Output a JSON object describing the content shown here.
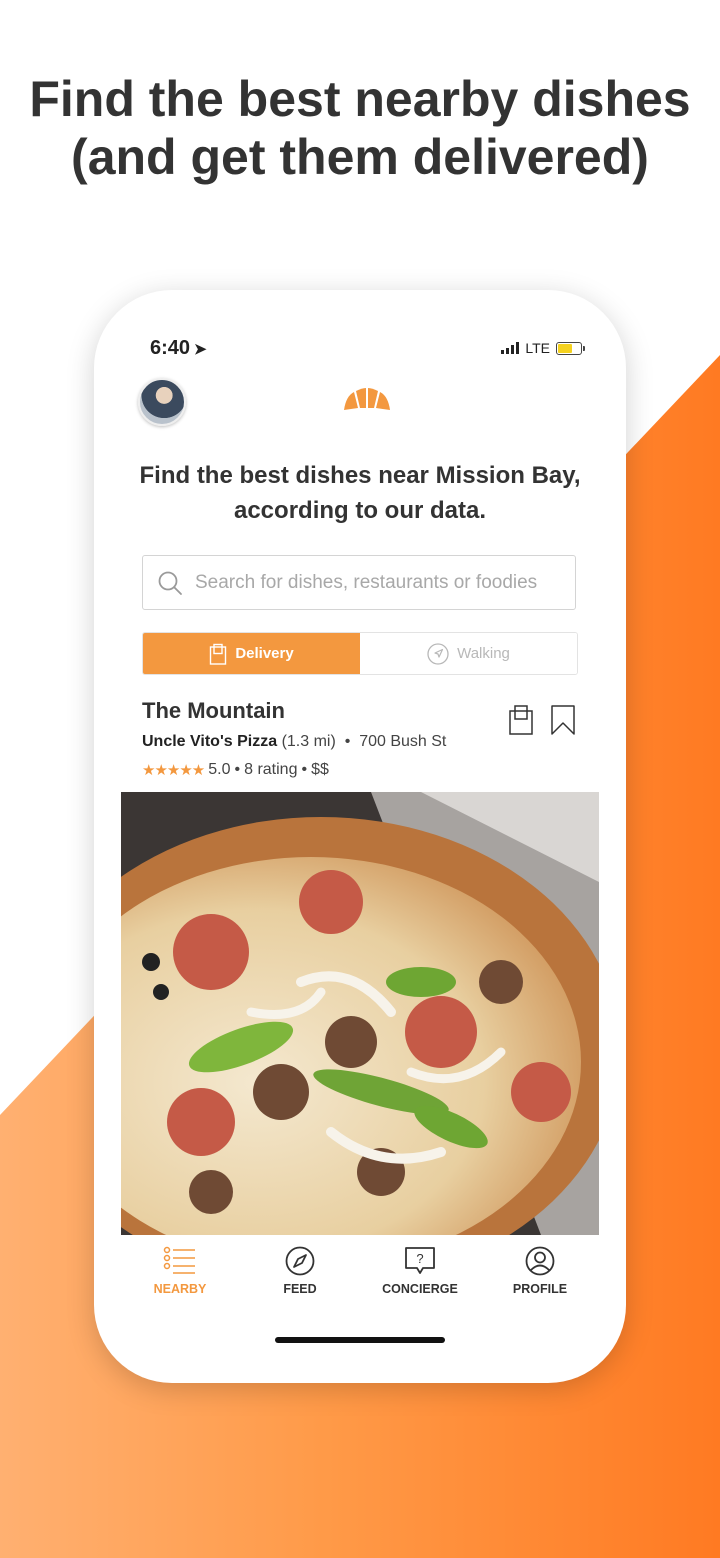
{
  "headline": {
    "line1": "Find the best nearby dishes",
    "line2": "(and get them delivered)"
  },
  "colors": {
    "accent": "#f3983f",
    "background_orange": "#ff8a33"
  },
  "status_bar": {
    "time": "6:40",
    "network": "LTE"
  },
  "app": {
    "tagline": "Find the best dishes near Mission Bay, according to our data.",
    "search_placeholder": "Search for dishes, restaurants or foodies",
    "mode_toggle": {
      "delivery": "Delivery",
      "walking": "Walking",
      "selected": "Delivery"
    },
    "dish": {
      "name": "The Mountain",
      "restaurant": "Uncle Vito's Pizza",
      "distance": "(1.3 mi)",
      "address": "700 Bush St",
      "rating": "5.0",
      "rating_count": "8 rating",
      "price": "$$",
      "stars_icon": "star-icon"
    },
    "tabs": [
      {
        "label": "NEARBY",
        "icon": "list-icon"
      },
      {
        "label": "FEED",
        "icon": "compass-icon"
      },
      {
        "label": "CONCIERGE",
        "icon": "question-chat-icon"
      },
      {
        "label": "PROFILE",
        "icon": "user-icon"
      }
    ],
    "active_tab": "NEARBY"
  }
}
